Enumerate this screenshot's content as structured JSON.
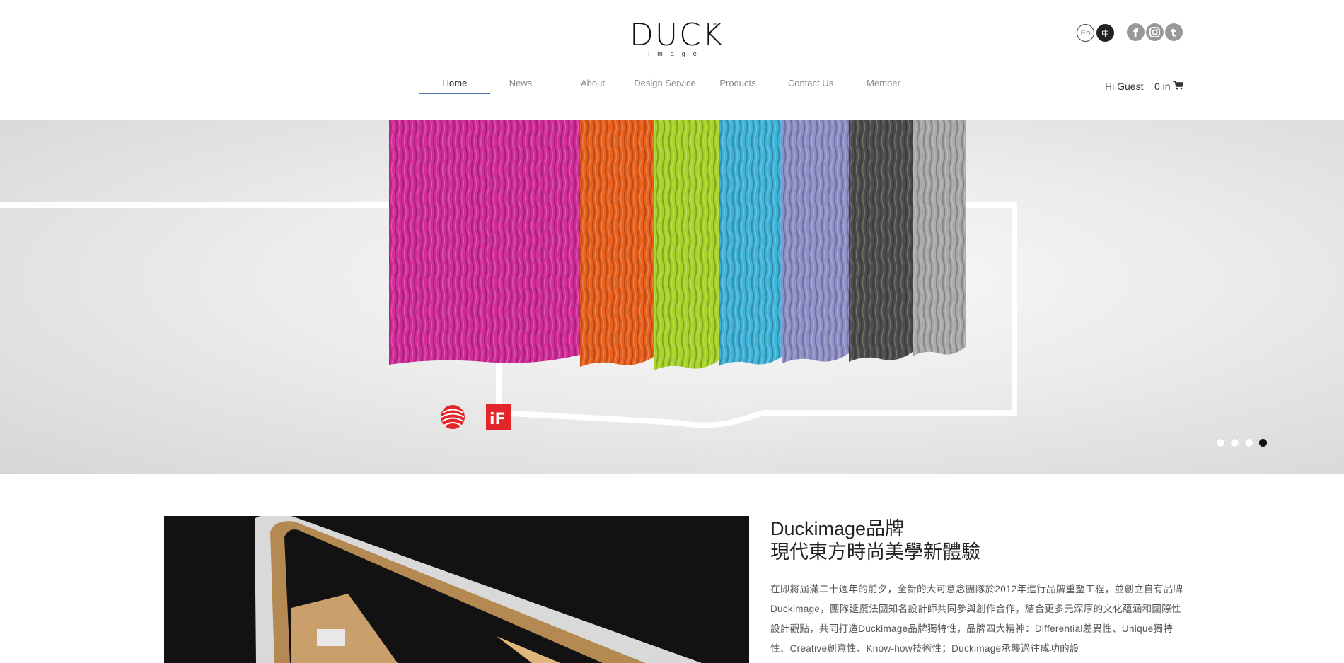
{
  "header": {
    "logo_text": "DUCK",
    "logo_subtext": "image",
    "logo_tm": "™",
    "languages": [
      {
        "label": "En",
        "active": false
      },
      {
        "label": "中",
        "active": true
      }
    ],
    "social": [
      {
        "icon": "facebook-icon",
        "glyph": "f"
      },
      {
        "icon": "instagram-icon",
        "glyph": "◎"
      },
      {
        "icon": "tumblr-icon",
        "glyph": "t"
      }
    ],
    "nav": {
      "items": [
        {
          "label": "Home",
          "active": true
        },
        {
          "label": "News",
          "active": false
        },
        {
          "label": "About",
          "active": false
        },
        {
          "label": "Design Service",
          "active": false
        },
        {
          "label": "Products",
          "active": false
        },
        {
          "label": "Contact Us",
          "active": false
        },
        {
          "label": "Member",
          "active": false
        }
      ]
    },
    "greeting": "Hi Guest",
    "cart_label": "0 in",
    "cart_icon": "cart-icon"
  },
  "hero": {
    "slide_count": 4,
    "active_slide": 4,
    "product_colors": [
      "#d12c9a",
      "#e8601e",
      "#a6d42a",
      "#3fb4d8",
      "#8f90c8",
      "#4d4d4d",
      "#a9a9a9"
    ],
    "awards": [
      "reddot-award-icon",
      "if-award-icon"
    ]
  },
  "content": {
    "title_line1": "Duckimage品牌",
    "title_line2": "現代東方時尚美學新體驗",
    "description": "在即將屆滿二十週年的前夕，全新的大可意念團隊於2012年進行品牌重塑工程，並創立自有品牌 Duckimage，團隊延攬法國知名設計師共同參與創作合作，結合更多元深厚的文化蘊涵和國際性設計觀點，共同打造Duckimage品牌獨特性，品牌四大精神：Differential差異性、Unique獨特性、Creative創意性、Know-how技術性；Duckimage承襲過往成功的設"
  }
}
